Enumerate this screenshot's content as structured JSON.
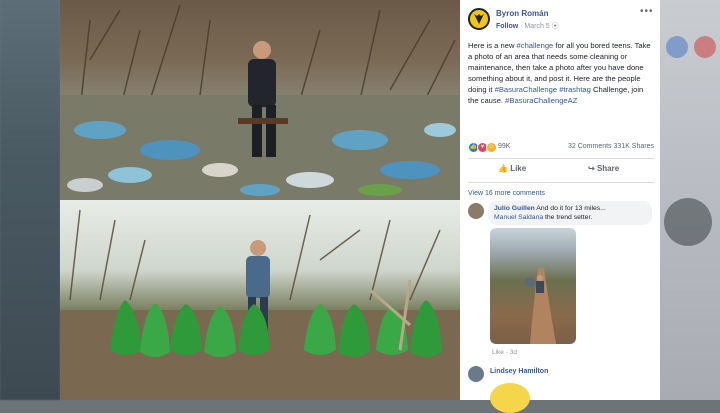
{
  "post": {
    "author": "Byron Román",
    "follow_label": "Follow",
    "date": "March 5",
    "more_label": "•••",
    "text_parts": {
      "p1": "Here is a new ",
      "tag1": "#challenge",
      "p2": " for all you bored teens. Take a photo of an area that needs some cleaning or maintenance, then take a photo after you have done something about it, and post it. Here are the people doing it ",
      "tag2": "#BasuraChallenge",
      "p3": " ",
      "tag3": "#trashtag",
      "p4": " Challenge, join the cause. ",
      "tag4": "#BasuraChallengeAZ"
    },
    "reaction_count": "99K",
    "comments_count": "32 Comments",
    "shares_count": "331K Shares",
    "like_label": "Like",
    "share_label": "Share",
    "view_more": "View 16 more comments"
  },
  "comments": [
    {
      "name": "Julio Guillen",
      "text": " And do it for 13 miles...",
      "mention": "Manuel Saldana",
      "mention_text": " the trend setter."
    },
    {
      "name": "Lindsey Hamilton"
    }
  ],
  "comment_meta": {
    "like_time": "Like · 3d"
  },
  "colors": {
    "link": "#365899",
    "text": "#1d2129",
    "muted": "#606770",
    "like_blue": "#1877f2",
    "heart_red": "#f33e58",
    "haha_yellow": "#f7b125"
  }
}
